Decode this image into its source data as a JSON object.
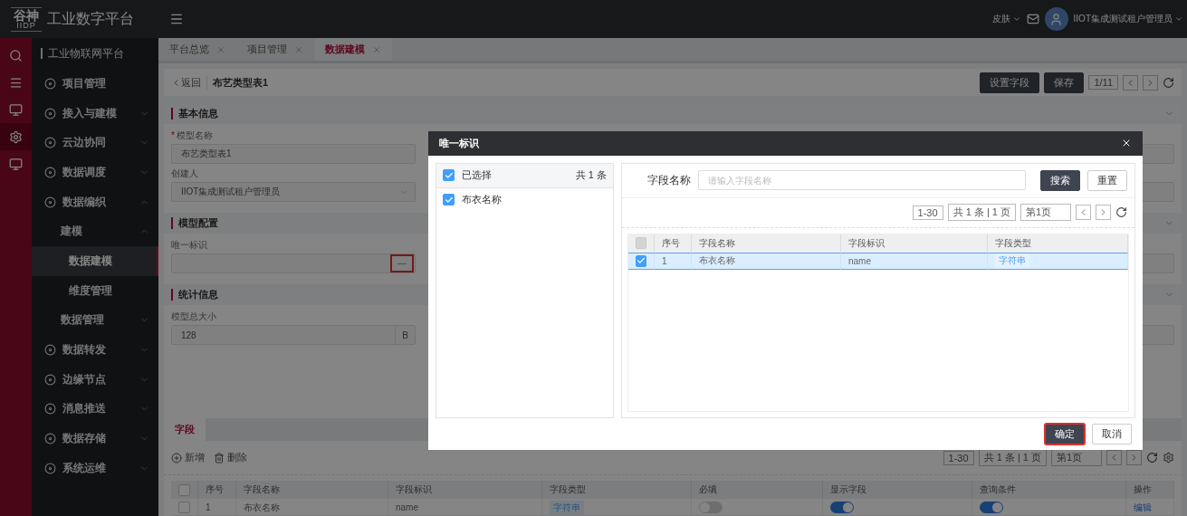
{
  "header": {
    "logo_mark": "谷神",
    "logo_sub": "IIDP",
    "title": "工业数字平台",
    "skin": "皮肤",
    "user": "IIOT集成测试租户管理员"
  },
  "rail": [
    {
      "kind": "search",
      "selected": false
    },
    {
      "kind": "menu",
      "selected": false
    },
    {
      "kind": "monitor",
      "selected": false
    },
    {
      "kind": "gear",
      "selected": true
    },
    {
      "kind": "monitor",
      "selected": false
    }
  ],
  "sidebar": {
    "title": "工业物联网平台",
    "items": [
      {
        "label": "项目管理",
        "selected": false
      },
      {
        "label": "接入与建模",
        "selected": false,
        "expanded": false
      },
      {
        "label": "云边协同",
        "selected": false,
        "expanded": false
      },
      {
        "label": "数据调度",
        "selected": false,
        "expanded": false
      },
      {
        "label": "数据编织",
        "selected": false,
        "expanded": true,
        "children": [
          {
            "label": "建模",
            "selected": false,
            "expanded": true,
            "children": [
              {
                "label": "数据建模",
                "selected": true
              },
              {
                "label": "维度管理",
                "selected": false
              }
            ]
          },
          {
            "label": "数据管理",
            "selected": false,
            "expanded": false
          }
        ]
      },
      {
        "label": "数据转发",
        "selected": false,
        "expanded": false
      },
      {
        "label": "边缘节点",
        "selected": false,
        "expanded": false
      },
      {
        "label": "消息推送",
        "selected": false,
        "expanded": false
      },
      {
        "label": "数据存储",
        "selected": false,
        "expanded": false
      },
      {
        "label": "系统运维",
        "selected": false,
        "expanded": false
      }
    ]
  },
  "tabs": [
    {
      "label": "平台总览",
      "selected": false
    },
    {
      "label": "项目管理",
      "selected": false
    },
    {
      "label": "数据建模",
      "selected": true
    }
  ],
  "page": {
    "back": "返回",
    "title": "布艺类型表1",
    "buttons": [
      "设置字段",
      "保存"
    ],
    "pager": "1/11"
  },
  "sections": [
    {
      "title": "基本信息",
      "fields": [
        {
          "label": "模型名称",
          "kind": "input",
          "marker": "*",
          "value": "布艺类型表1"
        },
        {
          "label": "创建人",
          "kind": "select",
          "value": "IIOT集成测试租户管理员"
        }
      ]
    },
    {
      "title": "模型配置",
      "fields": [
        {
          "label": "唯一标识",
          "kind": "picker",
          "highlighted": true
        }
      ]
    },
    {
      "title": "统计信息",
      "fields": [
        {
          "label": "模型总大小",
          "kind": "addon",
          "value": "128",
          "addon": "B"
        }
      ]
    }
  ],
  "fields_card": {
    "tab": "字段",
    "actions": [
      {
        "kind": "add",
        "label": "新增"
      },
      {
        "kind": "delete",
        "label": "删除"
      }
    ],
    "pagination": {
      "range": "1-30",
      "total": "共 1 条 | 1 页",
      "page": "第1页"
    },
    "table": {
      "header_checked": false,
      "columns": [
        "序号",
        "字段名称",
        "字段标识",
        "字段类型",
        "必填",
        "显示字段",
        "查询条件",
        "操作"
      ],
      "rows": [
        {
          "checked": false,
          "index": "1",
          "name": "布衣名称",
          "key": "name",
          "type": "字符串",
          "required": false,
          "display": true,
          "query": true,
          "action": "编辑"
        }
      ]
    }
  },
  "modal": {
    "title": "唯一标识",
    "selected_panel": {
      "title": "已选择",
      "checked": true,
      "count": "共 1 条",
      "items": [
        {
          "label": "布衣名称",
          "checked": true
        }
      ]
    },
    "search": {
      "label": "字段名称",
      "placeholder": "请输入字段名称",
      "buttons": [
        "搜索",
        "重置"
      ]
    },
    "pagination": {
      "range": "1-30",
      "total": "共 1 条 | 1 页",
      "page": "第1页"
    },
    "table": {
      "header_disabled": true,
      "columns": [
        "序号",
        "字段名称",
        "字段标识",
        "字段类型"
      ],
      "rows": [
        {
          "selected": true,
          "checked": true,
          "index": "1",
          "name": "布衣名称",
          "key": "name",
          "type": "字符串"
        }
      ]
    },
    "buttons": [
      {
        "label": "确定",
        "kind": "primary",
        "highlighted": true
      },
      {
        "label": "取消",
        "kind": "default",
        "highlighted": false
      }
    ]
  }
}
